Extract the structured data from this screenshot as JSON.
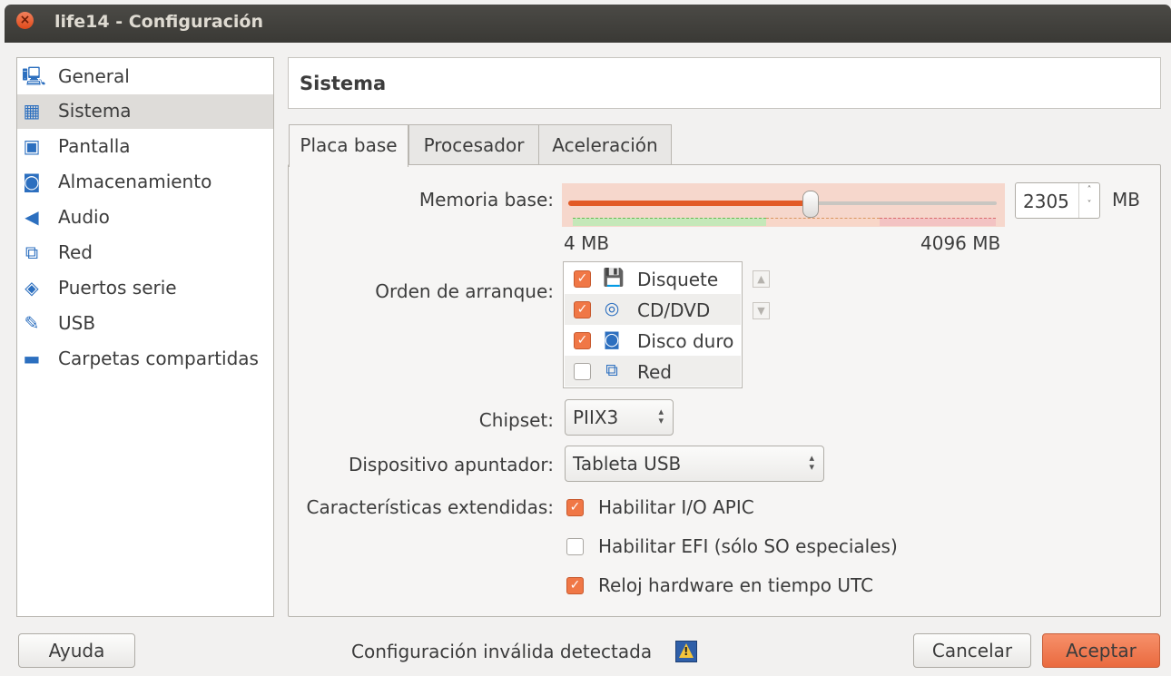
{
  "window": {
    "title": "life14 - Configuración"
  },
  "sidebar": {
    "items": [
      {
        "label": "General",
        "icon": "monitor-icon"
      },
      {
        "label": "Sistema",
        "icon": "motherboard-icon",
        "selected": true
      },
      {
        "label": "Pantalla",
        "icon": "display-icon"
      },
      {
        "label": "Almacenamiento",
        "icon": "storage-icon"
      },
      {
        "label": "Audio",
        "icon": "speaker-icon"
      },
      {
        "label": "Red",
        "icon": "network-icon"
      },
      {
        "label": "Puertos serie",
        "icon": "serial-port-icon"
      },
      {
        "label": "USB",
        "icon": "usb-icon"
      },
      {
        "label": "Carpetas compartidas",
        "icon": "folder-icon"
      }
    ]
  },
  "header": {
    "title": "Sistema"
  },
  "tabs": [
    {
      "label": "Placa base",
      "selected": true
    },
    {
      "label": "Procesador"
    },
    {
      "label": "Aceleración"
    }
  ],
  "memory": {
    "label": "Memoria base:",
    "value": "2305",
    "unit": "MB",
    "min_label": "4 MB",
    "max_label": "4096 MB",
    "fraction": 0.5625
  },
  "boot": {
    "label": "Orden de arranque:",
    "items": [
      {
        "label": "Disquete",
        "checked": true,
        "icon": "floppy-icon"
      },
      {
        "label": "CD/DVD",
        "checked": true,
        "icon": "cdrom-icon"
      },
      {
        "label": "Disco duro",
        "checked": true,
        "icon": "harddisk-icon"
      },
      {
        "label": "Red",
        "checked": false,
        "icon": "network-icon"
      }
    ]
  },
  "chipset": {
    "label": "Chipset:",
    "value": "PIIX3"
  },
  "pointing": {
    "label": "Dispositivo apuntador:",
    "value": "Tableta USB"
  },
  "extended": {
    "label": "Características extendidas:",
    "options": [
      {
        "label": "Habilitar I/O APIC",
        "checked": true
      },
      {
        "label": "Habilitar EFI (sólo SO especiales)",
        "checked": false
      },
      {
        "label": "Reloj hardware en tiempo UTC",
        "checked": true
      }
    ]
  },
  "footer": {
    "help_label": "Ayuda",
    "status_text": "Configuración inválida detectada",
    "cancel_label": "Cancelar",
    "accept_label": "Aceptar"
  },
  "colors": {
    "accent": "#e9673b",
    "titlebar": "#3c3b37",
    "selection": "#dedcd9"
  }
}
